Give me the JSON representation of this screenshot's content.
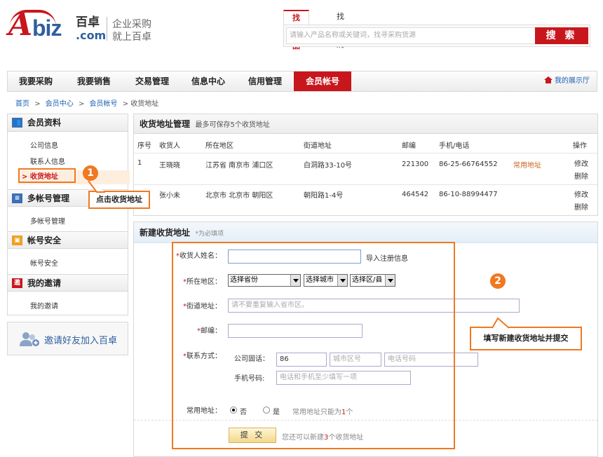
{
  "header": {
    "logo_a": "A",
    "logo_biz": "biz",
    "logo_cn": "百卓",
    "logo_com": ".com",
    "slogan_line1": "企业采购",
    "slogan_line2": "就上百卓",
    "search_tabs": [
      "找产品",
      "找采购"
    ],
    "search_placeholder": "请输入产品名称或关键词，找寻采购货源",
    "search_button": "搜 索"
  },
  "nav": {
    "items": [
      "我要采购",
      "我要销售",
      "交易管理",
      "信息中心",
      "信用管理",
      "会员帐号"
    ],
    "active_index": 5,
    "showroom": "我的展示厅"
  },
  "breadcrumb": [
    "首页",
    ">",
    "会员中心",
    ">",
    "会员帐号",
    "> 收货地址"
  ],
  "sidebar": {
    "sections": [
      {
        "title": "会员资料",
        "icon": "member-profile-icon",
        "items": [
          "公司信息",
          "联系人信息",
          "收货地址"
        ]
      },
      {
        "title": "多帐号管理",
        "icon": "multi-account-icon",
        "items": [
          "多帐号管理"
        ]
      },
      {
        "title": "帐号安全",
        "icon": "lock-icon",
        "items": [
          "帐号安全"
        ]
      },
      {
        "title": "我的邀请",
        "icon": "invite-icon",
        "items": [
          "我的邀请"
        ]
      }
    ],
    "current_arrow": ">",
    "invite_banner": "邀请好友加入百卓"
  },
  "address_panel": {
    "title": "收货地址管理",
    "subtitle": "最多可保存5个收货地址",
    "columns": [
      "序号",
      "收货人",
      "所在地区",
      "街道地址",
      "邮编",
      "手机/电话",
      "操作"
    ],
    "rows": [
      {
        "no": "1",
        "name": "王晓晓",
        "region": "江苏省  南京市  浦口区",
        "street": "白洞路33-10号",
        "zip": "221300",
        "phone": "86-25-66764552",
        "tag": "常用地址",
        "edit": "修改",
        "delete": "删除"
      },
      {
        "no": "",
        "name": "张小未",
        "region": "北京市  北京市  朝阳区",
        "street": "朝阳路1-4号",
        "zip": "464542",
        "phone": "86-10-88994477",
        "tag": "",
        "edit": "修改",
        "delete": "删除"
      }
    ]
  },
  "form": {
    "title": "新建收货地址",
    "subtitle": "*为必填项",
    "req_mark": "*",
    "name_label": "收货人姓名：",
    "import_link": "导入注册信息",
    "region_label": "所在地区：",
    "province": "选择省份",
    "city": "选择城市",
    "district": "选择区/县",
    "street_label": "街道地址：",
    "street_placeholder": "请不要重复输入省市区。",
    "zip_label": "邮编：",
    "contact_label": "联系方式：",
    "landline_label": "公司固话：",
    "country_code": "86",
    "area_code_placeholder": "城市区号",
    "phone_placeholder": "电话号码",
    "mobile_label": "手机号码:",
    "mobile_placeholder": "电话和手机至少填写一项",
    "default_label": "常用地址：",
    "option_no": "否",
    "option_yes": "是",
    "default_note_prefix": "常用地址只能为",
    "default_note_count": "1",
    "default_note_suffix": "个",
    "submit": "提 交",
    "remain_prefix": "您还可以新建",
    "remain_count": "3",
    "remain_suffix": "个收货地址"
  },
  "annotations": {
    "step1_number": "1",
    "step1_text": "点击收货地址",
    "step2_number": "2",
    "step2_text": "填写新建收货地址并提交",
    "accent_color": "#f07820"
  }
}
